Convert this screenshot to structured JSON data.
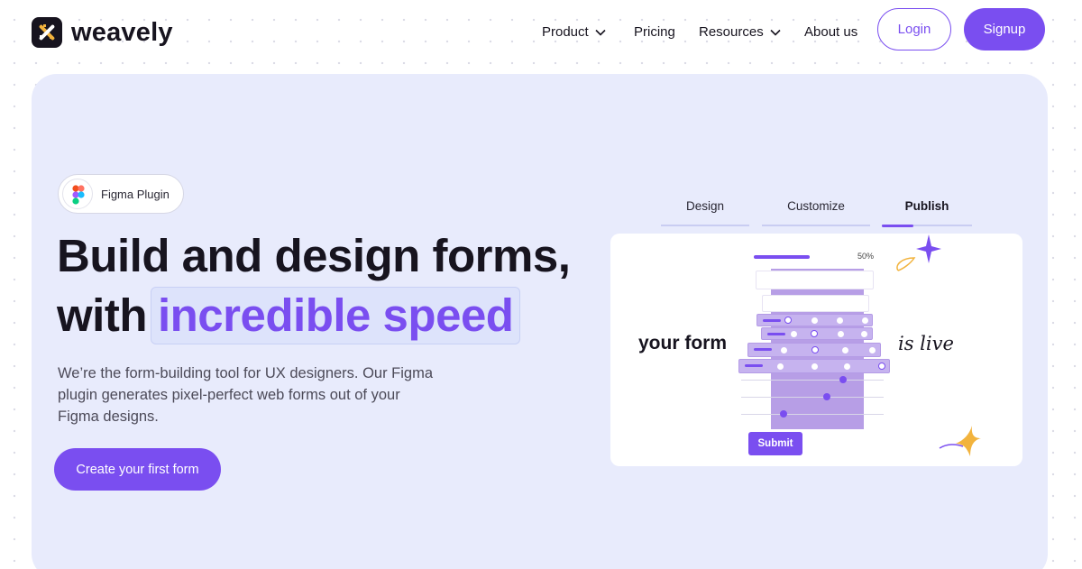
{
  "brand": {
    "name": "weavely",
    "accent": "#7a4ef0",
    "dark": "#17141f",
    "hero_bg": "#e8ebfc"
  },
  "nav": {
    "items": [
      {
        "label": "Product",
        "has_dropdown": true
      },
      {
        "label": "Pricing",
        "has_dropdown": false
      },
      {
        "label": "Resources",
        "has_dropdown": true
      },
      {
        "label": "About us",
        "has_dropdown": false
      }
    ],
    "login_label": "Login",
    "signup_label": "Signup"
  },
  "hero": {
    "badge": {
      "label": "Figma Plugin",
      "icon": "figma-icon"
    },
    "title_line1": "Build and design forms,",
    "title_line2_prefix": "with",
    "title_line2_highlight": "incredible speed",
    "description": "We’re the form-building tool for UX designers. Our Figma plugin generates pixel-perfect web forms out of your Figma designs.",
    "cta_label": "Create your first form"
  },
  "tabs": [
    {
      "label": "Design",
      "active": false
    },
    {
      "label": "Customize",
      "active": false
    },
    {
      "label": "Publish",
      "active": true
    }
  ],
  "illustration": {
    "text_left": "your form",
    "text_right": "is live",
    "progress_label": "50%",
    "progress": 0.5,
    "submit_label": "Submit"
  }
}
